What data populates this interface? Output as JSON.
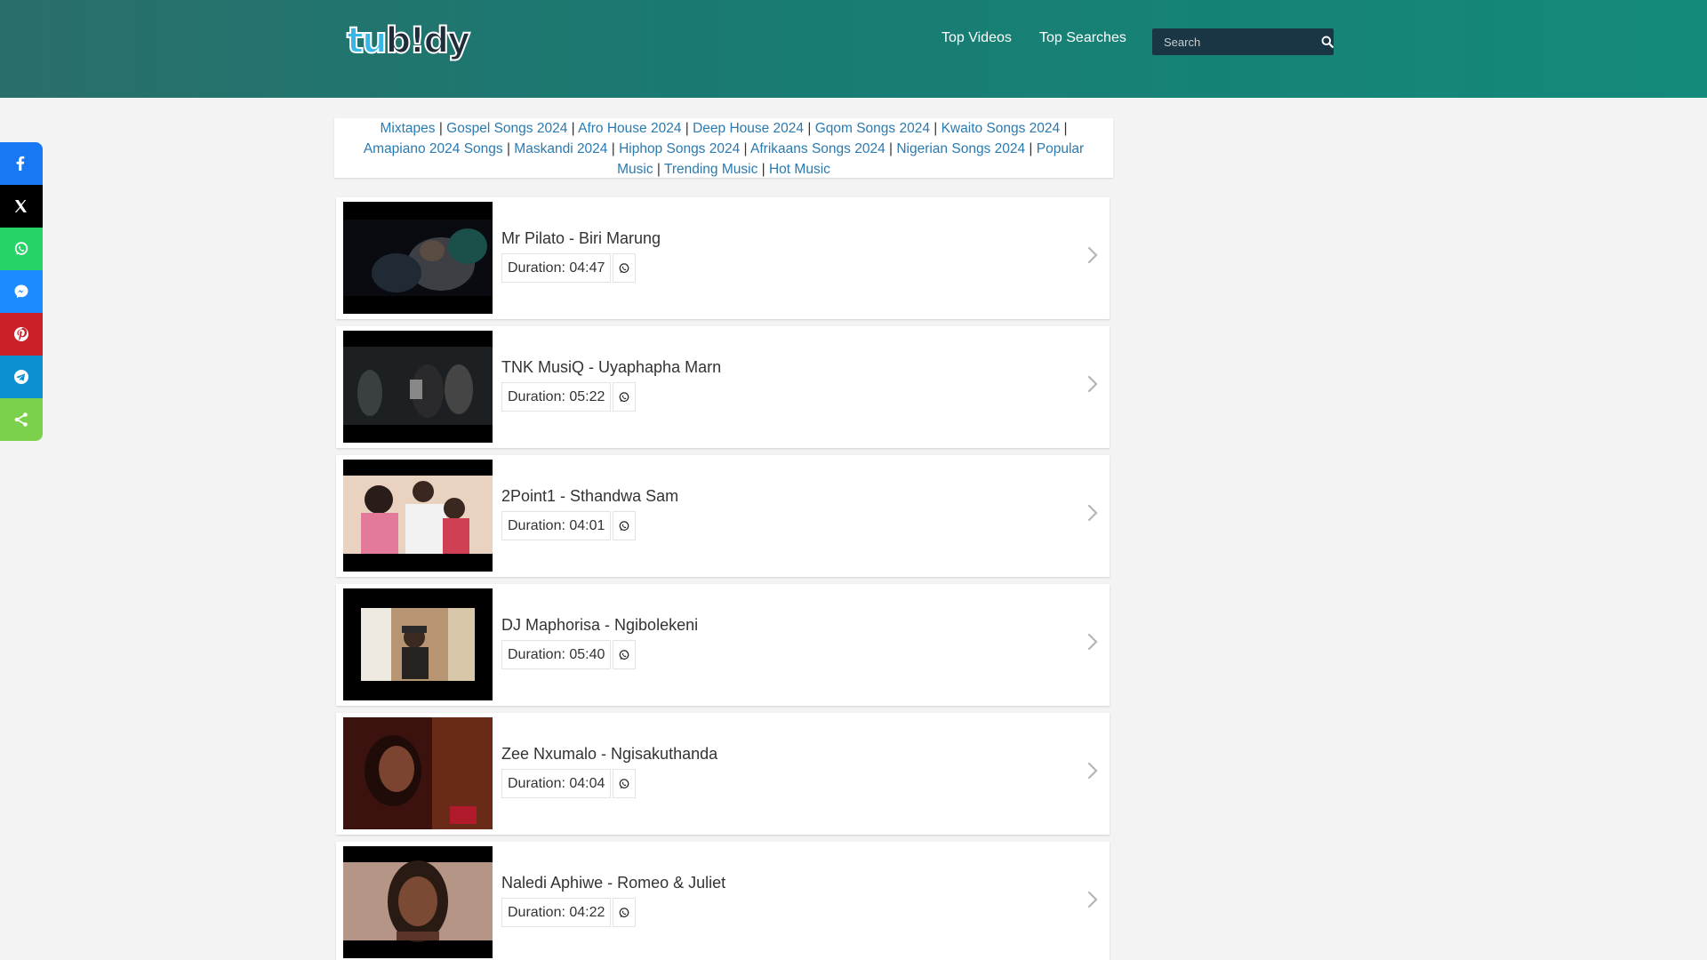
{
  "header": {
    "logo_part1": "tu",
    "logo_part2": "b!dy",
    "nav": [
      "Top Videos",
      "Top Searches"
    ],
    "search_placeholder": "Search"
  },
  "share_buttons": [
    {
      "name": "facebook-icon",
      "color": "#1877f2"
    },
    {
      "name": "x-twitter-icon",
      "color": "#000000"
    },
    {
      "name": "whatsapp-icon",
      "color": "#25d366"
    },
    {
      "name": "messenger-icon",
      "color": "#1b8bff"
    },
    {
      "name": "pinterest-icon",
      "color": "#cb2027"
    },
    {
      "name": "telegram-icon",
      "color": "#0d90d1"
    },
    {
      "name": "share-icon",
      "color": "#7bd14b"
    }
  ],
  "categories": [
    "Mixtapes",
    "Gospel Songs 2024",
    "Afro House 2024",
    "Deep House 2024",
    "Gqom Songs 2024",
    "Kwaito Songs 2024",
    "Amapiano 2024 Songs",
    "Maskandi 2024",
    "Hiphop Songs 2024",
    "Afrikaans Songs 2024",
    "Nigerian Songs 2024",
    "Popular Music",
    "Trending Music",
    "Hot Music"
  ],
  "videos": [
    {
      "title": "Mr Pilato - Biri Marung",
      "duration": "Duration: 04:47"
    },
    {
      "title": "TNK MusiQ - Uyaphapha Marn",
      "duration": "Duration: 05:22"
    },
    {
      "title": "2Point1 - Sthandwa Sam",
      "duration": "Duration: 04:01"
    },
    {
      "title": "DJ Maphorisa - Ngibolekeni",
      "duration": "Duration: 05:40"
    },
    {
      "title": "Zee Nxumalo - Ngisakuthanda",
      "duration": "Duration: 04:04"
    },
    {
      "title": "Naledi Aphiwe - Romeo & Juliet",
      "duration": "Duration: 04:22"
    }
  ],
  "colors": {
    "link": "#2a7ab0",
    "header_start": "#2a6e6a",
    "header_end": "#138a7a"
  }
}
